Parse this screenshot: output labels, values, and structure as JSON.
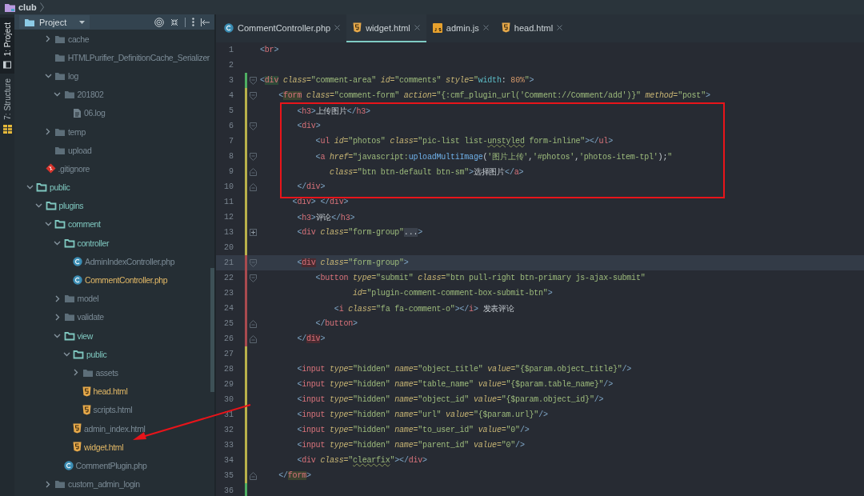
{
  "breadcrumb": {
    "label": "club"
  },
  "tool_strip": [
    {
      "label": "1: Project",
      "kind": "project",
      "selected": true
    },
    {
      "label": "7: Structure",
      "kind": "structure",
      "selected": false
    }
  ],
  "project_panel": {
    "view": "Project",
    "tree": [
      {
        "children": [
          {
            "children": [
              {
                "name": "cache",
                "kind": "dimfolder",
                "color": "#7b8b96",
                "expanded": false
              },
              {
                "name": "HTMLPurifier_DefinitionCache_Serializer",
                "kind": "dimfolder",
                "color": "#7b8b96"
              },
              {
                "name": "log",
                "kind": "dimfolder",
                "color": "#7b8b96",
                "expanded": true,
                "children": [
                  {
                    "name": "201802",
                    "kind": "dimfolder",
                    "color": "#7b8b96",
                    "expanded": true,
                    "children": [
                      {
                        "name": "06.log",
                        "kind": "textfile",
                        "color": "#7b8b96"
                      }
                    ]
                  }
                ]
              },
              {
                "name": "temp",
                "kind": "dimfolder",
                "color": "#7b8b96",
                "expanded": false
              },
              {
                "name": "upload",
                "kind": "dimfolder",
                "color": "#7b8b96"
              }
            ]
          },
          {
            "name": ".gitignore",
            "kind": "git",
            "color": "#7b8b96"
          }
        ]
      },
      {
        "name": "public",
        "kind": "folder",
        "color": "#7fc7bf",
        "expanded": true,
        "children": [
          {
            "name": "plugins",
            "kind": "folder",
            "color": "#7fc7bf",
            "expanded": true,
            "children": [
              {
                "name": "comment",
                "kind": "folder",
                "color": "#7fc7bf",
                "expanded": true,
                "children": [
                  {
                    "name": "controller",
                    "kind": "folder",
                    "color": "#7fc7bf",
                    "expanded": true,
                    "children": [
                      {
                        "name": "AdminIndexController.php",
                        "kind": "phpclass",
                        "color": "#7b8b96"
                      },
                      {
                        "name": "CommentController.php",
                        "kind": "phpclass",
                        "color": "#e2b866"
                      }
                    ]
                  },
                  {
                    "name": "model",
                    "kind": "dimfolder",
                    "color": "#7b8b96",
                    "expanded": false
                  },
                  {
                    "name": "validate",
                    "kind": "dimfolder",
                    "color": "#7b8b96",
                    "expanded": false
                  },
                  {
                    "name": "view",
                    "kind": "folder",
                    "color": "#7fc7bf",
                    "expanded": true,
                    "children": [
                      {
                        "name": "public",
                        "kind": "folder",
                        "color": "#7fc7bf",
                        "expanded": true,
                        "children": [
                          {
                            "name": "assets",
                            "kind": "dimfolder",
                            "color": "#7b8b96",
                            "expanded": false
                          },
                          {
                            "name": "head.html",
                            "kind": "html",
                            "color": "#e2b866"
                          },
                          {
                            "name": "scripts.html",
                            "kind": "html",
                            "color": "#7b8b96"
                          }
                        ]
                      },
                      {
                        "name": "admin_index.html",
                        "kind": "html",
                        "color": "#7b8b96"
                      },
                      {
                        "name": "widget.html",
                        "kind": "html",
                        "color": "#e2b866"
                      }
                    ]
                  },
                  {
                    "name": "CommentPlugin.php",
                    "kind": "phpclass",
                    "color": "#7b8b96"
                  }
                ]
              },
              {
                "name": "custom_admin_login",
                "kind": "dimfolder",
                "color": "#7b8b96",
                "expanded": false
              }
            ]
          }
        ]
      }
    ]
  },
  "editor_tabs": [
    {
      "label": "CommentController.php",
      "kind": "phpclass",
      "selected": false
    },
    {
      "label": "widget.html",
      "kind": "html",
      "selected": true
    },
    {
      "label": "admin.js",
      "kind": "js",
      "selected": false
    },
    {
      "label": "head.html",
      "kind": "html",
      "selected": false
    }
  ],
  "code_lines": [
    {
      "number": "1",
      "kind": "plain",
      "current": false,
      "tokens": [
        {
          "kind": "p",
          "text": "<"
        },
        {
          "kind": "tag",
          "text": "br"
        },
        {
          "kind": "p",
          "text": ">"
        }
      ]
    },
    {
      "number": "2",
      "kind": "plain",
      "current": false
    },
    {
      "number": "3",
      "kind": "opener",
      "current": false,
      "color": "#4fae62",
      "tokens": [
        {
          "kind": "p",
          "text": "<"
        },
        {
          "kind": "tag",
          "text": "div",
          "color": "#2e4a38"
        },
        {
          "kind": "attr",
          "text": " class="
        },
        {
          "kind": "str",
          "text": "\"comment-area\""
        },
        {
          "kind": "attr",
          "text": " id="
        },
        {
          "kind": "str",
          "text": "\"comments\""
        },
        {
          "kind": "attr",
          "text": " style="
        },
        {
          "kind": "str",
          "text": "\""
        },
        {
          "kind": "prop",
          "text": "width"
        },
        {
          "kind": "text",
          "text": ": "
        },
        {
          "kind": "num",
          "text": "80%"
        },
        {
          "kind": "str",
          "text": "\""
        },
        {
          "kind": "p",
          "text": ">"
        }
      ]
    },
    {
      "number": "4",
      "kind": "opener",
      "current": false,
      "color": "#b8b04a",
      "tokens": [
        {
          "kind": "p",
          "text": "    <"
        },
        {
          "kind": "tag",
          "text": "form",
          "color": "#3b4330"
        },
        {
          "kind": "attr",
          "text": " class="
        },
        {
          "kind": "str",
          "text": "\"comment-form\""
        },
        {
          "kind": "attr",
          "text": " action="
        },
        {
          "kind": "str",
          "text": "\"{:cmf_plugin_url('Comment://Comment/add')}\""
        },
        {
          "kind": "attr",
          "text": " method="
        },
        {
          "kind": "str",
          "text": "\"post\""
        },
        {
          "kind": "p",
          "text": ">"
        }
      ]
    },
    {
      "number": "5",
      "kind": "plain",
      "current": false,
      "color": "#b8b04a",
      "tokens": [
        {
          "kind": "p",
          "text": "        <"
        },
        {
          "kind": "tag",
          "text": "h3"
        },
        {
          "kind": "p",
          "text": ">"
        },
        {
          "kind": "text",
          "text": "上传图片"
        },
        {
          "kind": "p",
          "text": "</"
        },
        {
          "kind": "tag",
          "text": "h3"
        },
        {
          "kind": "p",
          "text": ">"
        }
      ]
    },
    {
      "number": "6",
      "kind": "opener",
      "current": false,
      "color": "#b8b04a",
      "tokens": [
        {
          "kind": "p",
          "text": "        <"
        },
        {
          "kind": "tag",
          "text": "div"
        },
        {
          "kind": "p",
          "text": ">"
        }
      ]
    },
    {
      "number": "7",
      "kind": "plain",
      "current": false,
      "color": "#b8b04a",
      "tokens": [
        {
          "kind": "p",
          "text": "            <"
        },
        {
          "kind": "tag",
          "text": "ul"
        },
        {
          "kind": "attr",
          "text": " id="
        },
        {
          "kind": "str",
          "text": "\"photos\""
        },
        {
          "kind": "attr",
          "text": " class="
        },
        {
          "kind": "str",
          "text": "\"pic-list list-"
        },
        {
          "kind": "str",
          "text": "unstyled",
          "wavy": true
        },
        {
          "kind": "str",
          "text": " form-inline\""
        },
        {
          "kind": "p",
          "text": "></"
        },
        {
          "kind": "tag",
          "text": "ul"
        },
        {
          "kind": "p",
          "text": ">"
        }
      ]
    },
    {
      "number": "8",
      "kind": "opener",
      "current": false,
      "color": "#b8b04a",
      "tokens": [
        {
          "kind": "p",
          "text": "            <"
        },
        {
          "kind": "tag",
          "text": "a"
        },
        {
          "kind": "attr",
          "text": " href="
        },
        {
          "kind": "str",
          "text": "\"javascript:"
        },
        {
          "kind": "fn",
          "text": "uploadMultiImage"
        },
        {
          "kind": "text",
          "text": "("
        },
        {
          "kind": "str",
          "text": "'图片上传'"
        },
        {
          "kind": "text",
          "text": ","
        },
        {
          "kind": "str",
          "text": "'#photos'"
        },
        {
          "kind": "text",
          "text": ","
        },
        {
          "kind": "str",
          "text": "'photos-item-tpl'"
        },
        {
          "kind": "text",
          "text": ");"
        },
        {
          "kind": "str",
          "text": "\""
        }
      ]
    },
    {
      "number": "9",
      "kind": "closer",
      "current": false,
      "color": "#b8b04a",
      "tokens": [
        {
          "kind": "attr",
          "text": "               class="
        },
        {
          "kind": "str",
          "text": "\"btn btn-default btn-sm\""
        },
        {
          "kind": "p",
          "text": ">"
        },
        {
          "kind": "text",
          "text": "选择图片"
        },
        {
          "kind": "p",
          "text": "</"
        },
        {
          "kind": "tag",
          "text": "a"
        },
        {
          "kind": "p",
          "text": ">"
        }
      ]
    },
    {
      "number": "10",
      "kind": "closer",
      "current": false,
      "color": "#b8b04a",
      "tokens": [
        {
          "kind": "p",
          "text": "        </"
        },
        {
          "kind": "tag",
          "text": "div"
        },
        {
          "kind": "p",
          "text": ">"
        }
      ]
    },
    {
      "number": "11",
      "kind": "plain",
      "current": false,
      "color": "#b8b04a",
      "tokens": [
        {
          "kind": "p",
          "text": "       <"
        },
        {
          "kind": "tag",
          "text": "div"
        },
        {
          "kind": "p",
          "text": "> </"
        },
        {
          "kind": "tag",
          "text": "div"
        },
        {
          "kind": "p",
          "text": ">"
        }
      ]
    },
    {
      "number": "12",
      "kind": "plain",
      "current": false,
      "color": "#b8b04a",
      "tokens": [
        {
          "kind": "p",
          "text": "        <"
        },
        {
          "kind": "tag",
          "text": "h3"
        },
        {
          "kind": "p",
          "text": ">"
        },
        {
          "kind": "text",
          "text": "评论"
        },
        {
          "kind": "p",
          "text": "</"
        },
        {
          "kind": "tag",
          "text": "h3"
        },
        {
          "kind": "p",
          "text": ">"
        }
      ]
    },
    {
      "number": "13",
      "kind": "folded",
      "current": false,
      "color": "#b8b04a",
      "tokens": [
        {
          "kind": "p",
          "text": "        <"
        },
        {
          "kind": "tag",
          "text": "div"
        },
        {
          "kind": "attr",
          "text": " class="
        },
        {
          "kind": "str",
          "text": "\"form-group\""
        },
        {
          "kind": "folded",
          "text": "..."
        },
        {
          "kind": "p",
          "text": ">"
        }
      ]
    },
    {
      "number": "20",
      "kind": "plain",
      "current": false,
      "color": "#b8b04a"
    },
    {
      "number": "21",
      "kind": "opener",
      "current": true,
      "color": "#a84a4f",
      "tokens": [
        {
          "kind": "p",
          "text": "        <"
        },
        {
          "kind": "tag",
          "text": "div",
          "color": "#4a2a30"
        },
        {
          "kind": "attr",
          "text": " class="
        },
        {
          "kind": "str",
          "text": "\"form-group\""
        },
        {
          "kind": "p",
          "text": ">"
        }
      ]
    },
    {
      "number": "22",
      "kind": "opener",
      "current": false,
      "color": "#a84a4f",
      "tokens": [
        {
          "kind": "p",
          "text": "            <"
        },
        {
          "kind": "tag",
          "text": "button"
        },
        {
          "kind": "attr",
          "text": " type="
        },
        {
          "kind": "str",
          "text": "\"submit\""
        },
        {
          "kind": "attr",
          "text": " class="
        },
        {
          "kind": "str",
          "text": "\"btn pull-right btn-primary js-ajax-submit\""
        }
      ]
    },
    {
      "number": "23",
      "kind": "plain",
      "current": false,
      "color": "#a84a4f",
      "tokens": [
        {
          "kind": "attr",
          "text": "                    id="
        },
        {
          "kind": "str",
          "text": "\"plugin-comment-comment-box-submit-btn\""
        },
        {
          "kind": "p",
          "text": ">"
        }
      ]
    },
    {
      "number": "24",
      "kind": "plain",
      "current": false,
      "color": "#a84a4f",
      "tokens": [
        {
          "kind": "p",
          "text": "                <"
        },
        {
          "kind": "tag",
          "text": "i"
        },
        {
          "kind": "attr",
          "text": " class="
        },
        {
          "kind": "str",
          "text": "\"fa fa-comment-o\""
        },
        {
          "kind": "p",
          "text": "></"
        },
        {
          "kind": "tag",
          "text": "i"
        },
        {
          "kind": "p",
          "text": ">"
        },
        {
          "kind": "text",
          "text": " 发表评论"
        }
      ]
    },
    {
      "number": "25",
      "kind": "closer",
      "current": false,
      "color": "#a84a4f",
      "tokens": [
        {
          "kind": "p",
          "text": "            </"
        },
        {
          "kind": "tag",
          "text": "button"
        },
        {
          "kind": "p",
          "text": ">"
        }
      ]
    },
    {
      "number": "26",
      "kind": "closer",
      "current": false,
      "color": "#a84a4f",
      "tokens": [
        {
          "kind": "p",
          "text": "        </"
        },
        {
          "kind": "tag",
          "text": "div",
          "color": "#4a2a30"
        },
        {
          "kind": "p",
          "text": ">"
        }
      ]
    },
    {
      "number": "27",
      "kind": "plain",
      "current": false,
      "color": "#b8b04a"
    },
    {
      "number": "28",
      "kind": "plain",
      "current": false,
      "color": "#b8b04a",
      "tokens": [
        {
          "kind": "p",
          "text": "        <"
        },
        {
          "kind": "tag",
          "text": "input"
        },
        {
          "kind": "attr",
          "text": " type="
        },
        {
          "kind": "str",
          "text": "\"hidden\""
        },
        {
          "kind": "attr",
          "text": " name="
        },
        {
          "kind": "str",
          "text": "\"object_title\""
        },
        {
          "kind": "attr",
          "text": " value="
        },
        {
          "kind": "str",
          "text": "\"{$param.object_title}\""
        },
        {
          "kind": "p",
          "text": "/>"
        }
      ]
    },
    {
      "number": "29",
      "kind": "plain",
      "current": false,
      "color": "#b8b04a",
      "tokens": [
        {
          "kind": "p",
          "text": "        <"
        },
        {
          "kind": "tag",
          "text": "input"
        },
        {
          "kind": "attr",
          "text": " type="
        },
        {
          "kind": "str",
          "text": "\"hidden\""
        },
        {
          "kind": "attr",
          "text": " name="
        },
        {
          "kind": "str",
          "text": "\"table_name\""
        },
        {
          "kind": "attr",
          "text": " value="
        },
        {
          "kind": "str",
          "text": "\"{$param.table_name}\""
        },
        {
          "kind": "p",
          "text": "/>"
        }
      ]
    },
    {
      "number": "30",
      "kind": "plain",
      "current": false,
      "color": "#b8b04a",
      "tokens": [
        {
          "kind": "p",
          "text": "        <"
        },
        {
          "kind": "tag",
          "text": "input"
        },
        {
          "kind": "attr",
          "text": " type="
        },
        {
          "kind": "str",
          "text": "\"hidden\""
        },
        {
          "kind": "attr",
          "text": " name="
        },
        {
          "kind": "str",
          "text": "\"object_id\""
        },
        {
          "kind": "attr",
          "text": " value="
        },
        {
          "kind": "str",
          "text": "\"{$param.object_id}\""
        },
        {
          "kind": "p",
          "text": "/>"
        }
      ]
    },
    {
      "number": "31",
      "kind": "plain",
      "current": false,
      "color": "#b8b04a",
      "tokens": [
        {
          "kind": "p",
          "text": "        <"
        },
        {
          "kind": "tag",
          "text": "input"
        },
        {
          "kind": "attr",
          "text": " type="
        },
        {
          "kind": "str",
          "text": "\"hidden\""
        },
        {
          "kind": "attr",
          "text": " name="
        },
        {
          "kind": "str",
          "text": "\"url\""
        },
        {
          "kind": "attr",
          "text": " value="
        },
        {
          "kind": "str",
          "text": "\"{$param.url}\""
        },
        {
          "kind": "p",
          "text": "/>"
        }
      ]
    },
    {
      "number": "32",
      "kind": "plain",
      "current": false,
      "color": "#b8b04a",
      "tokens": [
        {
          "kind": "p",
          "text": "        <"
        },
        {
          "kind": "tag",
          "text": "input"
        },
        {
          "kind": "attr",
          "text": " type="
        },
        {
          "kind": "str",
          "text": "\"hidden\""
        },
        {
          "kind": "attr",
          "text": " name="
        },
        {
          "kind": "str",
          "text": "\"to_user_id\""
        },
        {
          "kind": "attr",
          "text": " value="
        },
        {
          "kind": "str",
          "text": "\"0\""
        },
        {
          "kind": "p",
          "text": "/>"
        }
      ]
    },
    {
      "number": "33",
      "kind": "plain",
      "current": false,
      "color": "#b8b04a",
      "tokens": [
        {
          "kind": "p",
          "text": "        <"
        },
        {
          "kind": "tag",
          "text": "input"
        },
        {
          "kind": "attr",
          "text": " type="
        },
        {
          "kind": "str",
          "text": "\"hidden\""
        },
        {
          "kind": "attr",
          "text": " name="
        },
        {
          "kind": "str",
          "text": "\"parent_id\""
        },
        {
          "kind": "attr",
          "text": " value="
        },
        {
          "kind": "str",
          "text": "\"0\""
        },
        {
          "kind": "p",
          "text": "/>"
        }
      ]
    },
    {
      "number": "34",
      "kind": "plain",
      "current": false,
      "color": "#b8b04a",
      "tokens": [
        {
          "kind": "p",
          "text": "        <"
        },
        {
          "kind": "tag",
          "text": "div"
        },
        {
          "kind": "attr",
          "text": " class="
        },
        {
          "kind": "str",
          "text": "\""
        },
        {
          "kind": "str",
          "text": "clearfix",
          "wavy": true
        },
        {
          "kind": "str",
          "text": "\""
        },
        {
          "kind": "p",
          "text": "></"
        },
        {
          "kind": "tag",
          "text": "div"
        },
        {
          "kind": "p",
          "text": ">"
        }
      ]
    },
    {
      "number": "35",
      "kind": "closer",
      "current": false,
      "color": "#b8b04a",
      "tokens": [
        {
          "kind": "p",
          "text": "    </"
        },
        {
          "kind": "tag",
          "text": "form",
          "color": "#3b4330"
        },
        {
          "kind": "p",
          "text": ">"
        }
      ]
    },
    {
      "number": "36",
      "kind": "plain",
      "current": false,
      "color": "#4fae62"
    }
  ],
  "annotations": {
    "highlight_frame": true,
    "arrow": true
  }
}
